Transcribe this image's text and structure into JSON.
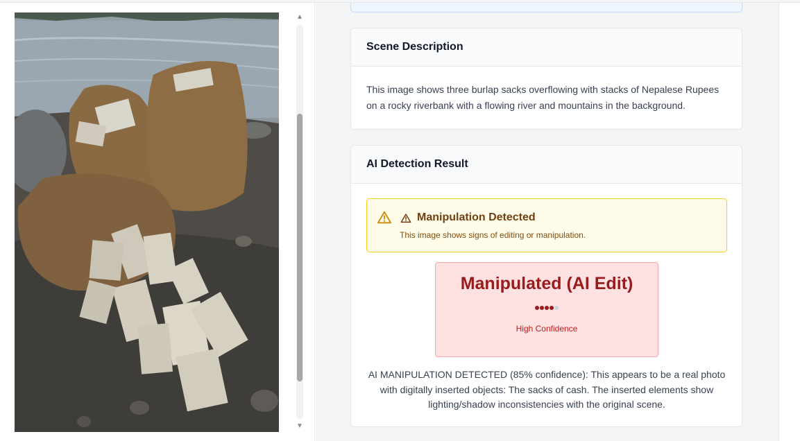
{
  "image_panel": {
    "alt": "Three burlap sacks overflowing with stacks of Nepalese Rupees on a rocky riverbank"
  },
  "scene_card": {
    "title": "Scene Description",
    "description": "This image shows three burlap sacks overflowing with stacks of Nepalese Rupees on a rocky riverbank with a flowing river and mountains in the background."
  },
  "detection_card": {
    "title": "AI Detection Result",
    "alert": {
      "title": "Manipulation Detected",
      "message": "This image shows signs of editing or manipulation."
    },
    "verdict": {
      "label": "Manipulated (AI Edit)",
      "confidence_level": 4,
      "confidence_max": 5,
      "confidence_text": "High Confidence"
    },
    "explanation": "AI MANIPULATION DETECTED (85% confidence): This appears to be a real photo with digitally inserted objects: The sacks of cash. The inserted elements show lighting/shadow inconsistencies with the original scene."
  },
  "icons": {
    "alert": "warning-triangle-icon",
    "alert_title": "warning-triangle-icon"
  },
  "colors": {
    "alert_bg": "#fefce8",
    "alert_border": "#facc15",
    "verdict_bg": "#fee2e2",
    "verdict_text": "#991b1b",
    "dot_filled": "#991b1b",
    "dot_empty": "#d1d5db"
  }
}
